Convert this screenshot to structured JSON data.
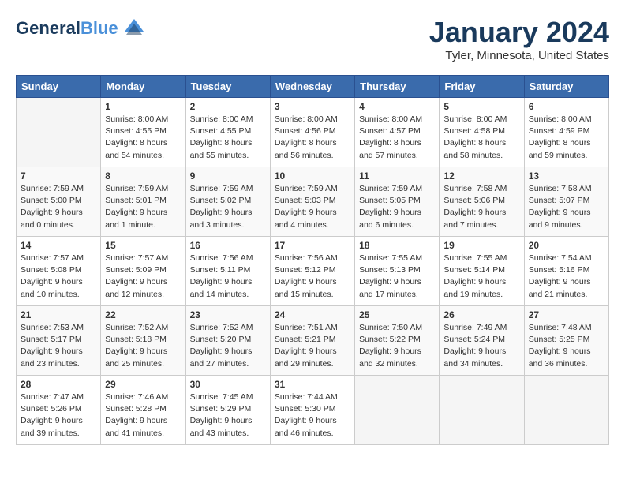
{
  "header": {
    "logo_line1": "General",
    "logo_line2": "Blue",
    "month": "January 2024",
    "location": "Tyler, Minnesota, United States"
  },
  "days_of_week": [
    "Sunday",
    "Monday",
    "Tuesday",
    "Wednesday",
    "Thursday",
    "Friday",
    "Saturday"
  ],
  "weeks": [
    [
      {
        "day": "",
        "info": ""
      },
      {
        "day": "1",
        "info": "Sunrise: 8:00 AM\nSunset: 4:55 PM\nDaylight: 8 hours\nand 54 minutes."
      },
      {
        "day": "2",
        "info": "Sunrise: 8:00 AM\nSunset: 4:55 PM\nDaylight: 8 hours\nand 55 minutes."
      },
      {
        "day": "3",
        "info": "Sunrise: 8:00 AM\nSunset: 4:56 PM\nDaylight: 8 hours\nand 56 minutes."
      },
      {
        "day": "4",
        "info": "Sunrise: 8:00 AM\nSunset: 4:57 PM\nDaylight: 8 hours\nand 57 minutes."
      },
      {
        "day": "5",
        "info": "Sunrise: 8:00 AM\nSunset: 4:58 PM\nDaylight: 8 hours\nand 58 minutes."
      },
      {
        "day": "6",
        "info": "Sunrise: 8:00 AM\nSunset: 4:59 PM\nDaylight: 8 hours\nand 59 minutes."
      }
    ],
    [
      {
        "day": "7",
        "info": "Sunrise: 7:59 AM\nSunset: 5:00 PM\nDaylight: 9 hours\nand 0 minutes."
      },
      {
        "day": "8",
        "info": "Sunrise: 7:59 AM\nSunset: 5:01 PM\nDaylight: 9 hours\nand 1 minute."
      },
      {
        "day": "9",
        "info": "Sunrise: 7:59 AM\nSunset: 5:02 PM\nDaylight: 9 hours\nand 3 minutes."
      },
      {
        "day": "10",
        "info": "Sunrise: 7:59 AM\nSunset: 5:03 PM\nDaylight: 9 hours\nand 4 minutes."
      },
      {
        "day": "11",
        "info": "Sunrise: 7:59 AM\nSunset: 5:05 PM\nDaylight: 9 hours\nand 6 minutes."
      },
      {
        "day": "12",
        "info": "Sunrise: 7:58 AM\nSunset: 5:06 PM\nDaylight: 9 hours\nand 7 minutes."
      },
      {
        "day": "13",
        "info": "Sunrise: 7:58 AM\nSunset: 5:07 PM\nDaylight: 9 hours\nand 9 minutes."
      }
    ],
    [
      {
        "day": "14",
        "info": "Sunrise: 7:57 AM\nSunset: 5:08 PM\nDaylight: 9 hours\nand 10 minutes."
      },
      {
        "day": "15",
        "info": "Sunrise: 7:57 AM\nSunset: 5:09 PM\nDaylight: 9 hours\nand 12 minutes."
      },
      {
        "day": "16",
        "info": "Sunrise: 7:56 AM\nSunset: 5:11 PM\nDaylight: 9 hours\nand 14 minutes."
      },
      {
        "day": "17",
        "info": "Sunrise: 7:56 AM\nSunset: 5:12 PM\nDaylight: 9 hours\nand 15 minutes."
      },
      {
        "day": "18",
        "info": "Sunrise: 7:55 AM\nSunset: 5:13 PM\nDaylight: 9 hours\nand 17 minutes."
      },
      {
        "day": "19",
        "info": "Sunrise: 7:55 AM\nSunset: 5:14 PM\nDaylight: 9 hours\nand 19 minutes."
      },
      {
        "day": "20",
        "info": "Sunrise: 7:54 AM\nSunset: 5:16 PM\nDaylight: 9 hours\nand 21 minutes."
      }
    ],
    [
      {
        "day": "21",
        "info": "Sunrise: 7:53 AM\nSunset: 5:17 PM\nDaylight: 9 hours\nand 23 minutes."
      },
      {
        "day": "22",
        "info": "Sunrise: 7:52 AM\nSunset: 5:18 PM\nDaylight: 9 hours\nand 25 minutes."
      },
      {
        "day": "23",
        "info": "Sunrise: 7:52 AM\nSunset: 5:20 PM\nDaylight: 9 hours\nand 27 minutes."
      },
      {
        "day": "24",
        "info": "Sunrise: 7:51 AM\nSunset: 5:21 PM\nDaylight: 9 hours\nand 29 minutes."
      },
      {
        "day": "25",
        "info": "Sunrise: 7:50 AM\nSunset: 5:22 PM\nDaylight: 9 hours\nand 32 minutes."
      },
      {
        "day": "26",
        "info": "Sunrise: 7:49 AM\nSunset: 5:24 PM\nDaylight: 9 hours\nand 34 minutes."
      },
      {
        "day": "27",
        "info": "Sunrise: 7:48 AM\nSunset: 5:25 PM\nDaylight: 9 hours\nand 36 minutes."
      }
    ],
    [
      {
        "day": "28",
        "info": "Sunrise: 7:47 AM\nSunset: 5:26 PM\nDaylight: 9 hours\nand 39 minutes."
      },
      {
        "day": "29",
        "info": "Sunrise: 7:46 AM\nSunset: 5:28 PM\nDaylight: 9 hours\nand 41 minutes."
      },
      {
        "day": "30",
        "info": "Sunrise: 7:45 AM\nSunset: 5:29 PM\nDaylight: 9 hours\nand 43 minutes."
      },
      {
        "day": "31",
        "info": "Sunrise: 7:44 AM\nSunset: 5:30 PM\nDaylight: 9 hours\nand 46 minutes."
      },
      {
        "day": "",
        "info": ""
      },
      {
        "day": "",
        "info": ""
      },
      {
        "day": "",
        "info": ""
      }
    ]
  ]
}
